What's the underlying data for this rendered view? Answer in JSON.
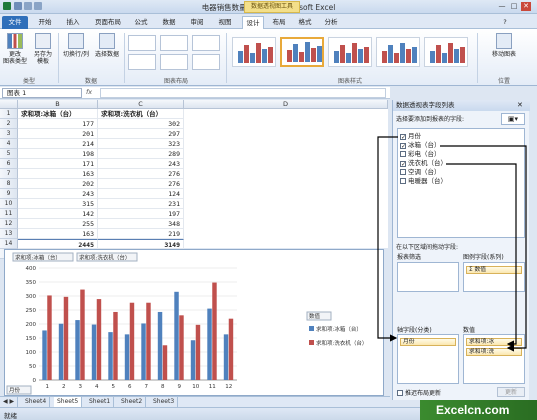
{
  "window": {
    "title": "电器销售数量表.xlsx - Microsoft Excel",
    "context_group": "数据透视图工具",
    "controls": [
      "—",
      "□",
      "✕"
    ]
  },
  "tabs": [
    "文件",
    "开始",
    "插入",
    "页面布局",
    "公式",
    "数据",
    "审阅",
    "视图",
    "设计",
    "布局",
    "格式",
    "分析"
  ],
  "active_tab": "设计",
  "ribbon": {
    "change_type": "更改\n图表类型",
    "save_template": "另存为\n模板",
    "switch_rowcol": "切换行/列",
    "select_data": "选择数据",
    "move_chart": "移动图表",
    "groups": {
      "type": "类型",
      "data": "数据",
      "layouts": "图表布局",
      "styles": "图表样式",
      "location": "位置"
    },
    "style_colors": [
      "#4f81bd",
      "#c0504d",
      "#4f81bd",
      "#c0504d",
      "#4f81bd",
      "#c0504d",
      "#4f81bd"
    ]
  },
  "formula_bar": {
    "name_box": "图表 1",
    "fx": "fx"
  },
  "sheet": {
    "col_headers": [
      "A",
      "B",
      "C",
      "D"
    ],
    "row_numbers": [
      "1",
      "2",
      "3",
      "4",
      "5",
      "6",
      "7",
      "8",
      "9",
      "10",
      "11",
      "12",
      "13",
      "14",
      "15"
    ],
    "header_b": "求和项:冰箱（台）",
    "header_c": "求和项:洗衣机（台）",
    "rows": [
      [
        "177",
        "302"
      ],
      [
        "201",
        "297"
      ],
      [
        "214",
        "323"
      ],
      [
        "198",
        "289"
      ],
      [
        "171",
        "243"
      ],
      [
        "163",
        "276"
      ],
      [
        "202",
        "276"
      ],
      [
        "243",
        "124"
      ],
      [
        "315",
        "231"
      ],
      [
        "142",
        "197"
      ],
      [
        "255",
        "348"
      ],
      [
        "163",
        "219"
      ]
    ],
    "total": [
      "2445",
      "3149"
    ]
  },
  "chart_data": {
    "type": "bar",
    "categories": [
      "1",
      "2",
      "3",
      "4",
      "5",
      "6",
      "7",
      "8",
      "9",
      "10",
      "11",
      "12"
    ],
    "series": [
      {
        "name": "求和项:冰箱（台）",
        "values": [
          177,
          201,
          214,
          198,
          171,
          163,
          202,
          243,
          315,
          142,
          255,
          163
        ],
        "color": "#4f81bd"
      },
      {
        "name": "求和项:洗衣机（台）",
        "values": [
          302,
          297,
          323,
          289,
          243,
          276,
          276,
          124,
          231,
          197,
          348,
          219
        ],
        "color": "#c0504d"
      }
    ],
    "ylim": [
      0,
      400
    ],
    "yticks": [
      "0",
      "50",
      "100",
      "150",
      "200",
      "250",
      "300",
      "350",
      "400"
    ],
    "field_buttons": [
      "求和项:冰箱（台）",
      "求和项:洗衣机（台）"
    ],
    "legend_title": "数值",
    "legend_position": "right",
    "axis_button": "月份"
  },
  "sheet_tabs": [
    "Sheet4",
    "Sheet5",
    "Sheet1",
    "Sheet2",
    "Sheet3"
  ],
  "active_sheet": "Sheet5",
  "status": {
    "ready": "就绪"
  },
  "pivot_pane": {
    "title": "数据透视表字段列表",
    "prompt": "选择要添加到报表的字段:",
    "fields": [
      {
        "label": "月份",
        "checked": true
      },
      {
        "label": "冰箱（台）",
        "checked": true
      },
      {
        "label": "彩电（台）",
        "checked": false
      },
      {
        "label": "洗衣机（台）",
        "checked": true
      },
      {
        "label": "空调（台）",
        "checked": false
      },
      {
        "label": "电暖器（台）",
        "checked": false
      }
    ],
    "drag_prompt": "在以下区域间拖动字段:",
    "zone_filter": "报表筛选",
    "zone_legend": "图例字段(系列)",
    "zone_axis": "轴字段(分类)",
    "zone_values": "数值",
    "legend_item": "Σ 数值",
    "axis_item": "月份",
    "value_items": [
      "求和项:冰",
      "求和项:洗"
    ],
    "defer_label": "推迟布局更新",
    "update_button": "更新"
  },
  "watermark": "Excelcn.com"
}
